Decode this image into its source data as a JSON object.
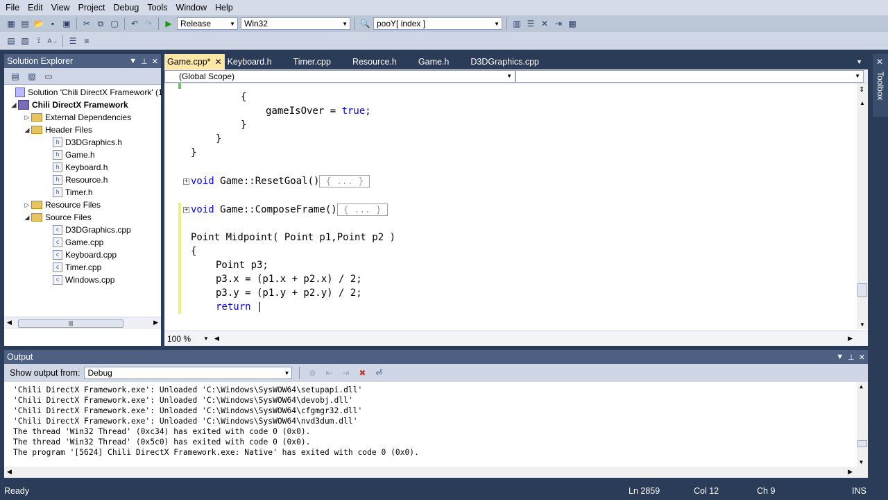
{
  "menu": [
    "File",
    "Edit",
    "View",
    "Project",
    "Debug",
    "Tools",
    "Window",
    "Help"
  ],
  "toolbar": {
    "configuration": "Release",
    "platform": "Win32",
    "find_value": "pooY[ index ]"
  },
  "solution_explorer": {
    "title": "Solution Explorer",
    "solution": "Solution 'Chili DirectX Framework' (1",
    "project": "Chili DirectX Framework",
    "external_deps": "External Dependencies",
    "header_folder": "Header Files",
    "headers": [
      "D3DGraphics.h",
      "Game.h",
      "Keyboard.h",
      "Resource.h",
      "Timer.h"
    ],
    "resource_folder": "Resource Files",
    "source_folder": "Source Files",
    "sources": [
      "D3DGraphics.cpp",
      "Game.cpp",
      "Keyboard.cpp",
      "Timer.cpp",
      "Windows.cpp"
    ]
  },
  "editor": {
    "tabs": [
      "Game.cpp*",
      "Keyboard.h",
      "Timer.cpp",
      "Resource.h",
      "Game.h",
      "D3DGraphics.cpp"
    ],
    "scope": "(Global Scope)",
    "zoom": "100 %",
    "code": {
      "l1": "{",
      "l2_a": "gameIsOver = ",
      "l2_kw": "true",
      "l2_b": ";",
      "l3": "}",
      "l4": "}",
      "l5": "}",
      "reset_kw": "void",
      "reset_sig": " Game::ResetGoal()",
      "collapsed": "{ ... }",
      "compose_kw": "void",
      "compose_sig": " Game::ComposeFrame()",
      "mid_sig": "Point Midpoint( Point p1,Point p2 )",
      "mid_open": "{",
      "m1": "Point p3;",
      "m2": "p3.x = (p1.x + p2.x) / 2;",
      "m3": "p3.y = (p1.y + p2.y) / 2;",
      "m4_kw": "return",
      "m4_tail": " |"
    }
  },
  "output": {
    "title": "Output",
    "show_from_label": "Show output from:",
    "source": "Debug",
    "lines": [
      "'Chili DirectX Framework.exe': Unloaded 'C:\\Windows\\SysWOW64\\setupapi.dll'",
      "'Chili DirectX Framework.exe': Unloaded 'C:\\Windows\\SysWOW64\\devobj.dll'",
      "'Chili DirectX Framework.exe': Unloaded 'C:\\Windows\\SysWOW64\\cfgmgr32.dll'",
      "'Chili DirectX Framework.exe': Unloaded 'C:\\Windows\\SysWOW64\\nvd3dum.dll'",
      "The thread 'Win32 Thread' (0xc34) has exited with code 0 (0x0).",
      "The thread 'Win32 Thread' (0x5c0) has exited with code 0 (0x0).",
      "The program '[5624] Chili DirectX Framework.exe: Native' has exited with code 0 (0x0)."
    ]
  },
  "toolbox_label": "Toolbox",
  "status": {
    "state": "Ready",
    "line": "Ln 2859",
    "col": "Col 12",
    "ch": "Ch 9",
    "mode": "INS"
  }
}
